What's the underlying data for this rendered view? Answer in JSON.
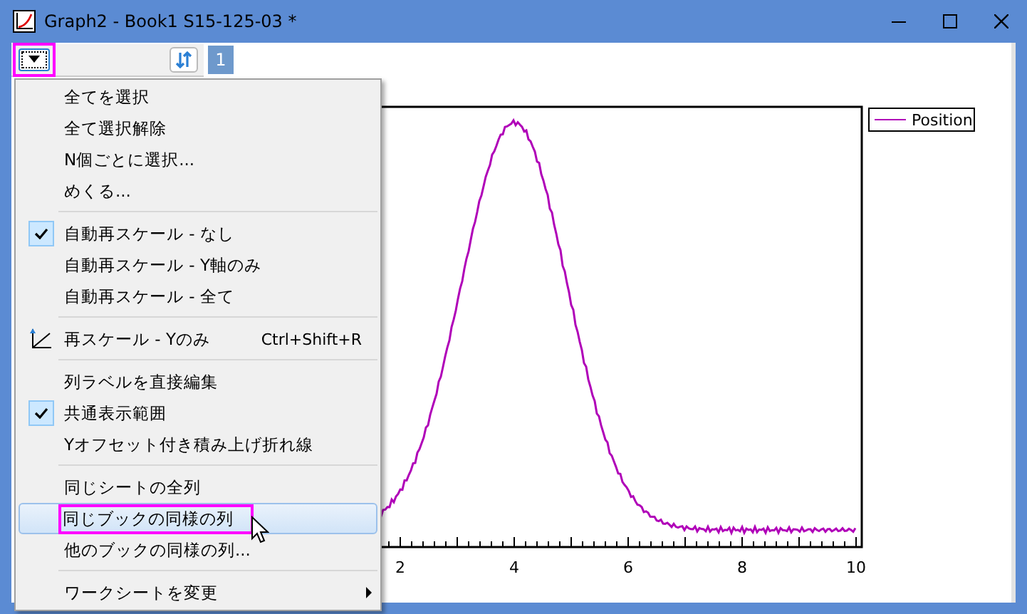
{
  "window": {
    "title": "Graph2 - Book1 S15-125-03 *"
  },
  "toolbar": {
    "dropdown_marked": true,
    "page_tabs": [
      {
        "label": "1",
        "selected": true
      }
    ]
  },
  "menu": {
    "items": [
      {
        "kind": "item",
        "label": "全てを選択",
        "checked": false,
        "selected": false,
        "marked": false
      },
      {
        "kind": "item",
        "label": "全て選択解除",
        "checked": false,
        "selected": false,
        "marked": false
      },
      {
        "kind": "item",
        "label": "N個ごとに選択...",
        "checked": false,
        "selected": false,
        "marked": false
      },
      {
        "kind": "item",
        "label": "めくる...",
        "checked": false,
        "selected": false,
        "marked": false
      },
      {
        "kind": "separator"
      },
      {
        "kind": "item",
        "label": "自動再スケール - なし",
        "checked": true,
        "selected": false,
        "marked": false
      },
      {
        "kind": "item",
        "label": "自動再スケール - Y軸のみ",
        "checked": false,
        "selected": false,
        "marked": false
      },
      {
        "kind": "item",
        "label": "自動再スケール - 全て",
        "checked": false,
        "selected": false,
        "marked": false
      },
      {
        "kind": "separator"
      },
      {
        "kind": "tool",
        "label": "再スケール - Yのみ",
        "shortcut": "Ctrl+Shift+R",
        "checked": false,
        "selected": false,
        "marked": false
      },
      {
        "kind": "separator"
      },
      {
        "kind": "item",
        "label": "列ラベルを直接編集",
        "checked": false,
        "selected": false,
        "marked": false
      },
      {
        "kind": "item",
        "label": "共通表示範囲",
        "checked": true,
        "selected": false,
        "marked": false
      },
      {
        "kind": "item",
        "label": "Yオフセット付き積み上げ折れ線",
        "checked": false,
        "selected": false,
        "marked": false
      },
      {
        "kind": "separator"
      },
      {
        "kind": "item",
        "label": "同じシートの全列",
        "checked": false,
        "selected": false,
        "marked": false
      },
      {
        "kind": "item",
        "label": "同じブックの同様の列",
        "checked": false,
        "selected": true,
        "marked": true
      },
      {
        "kind": "item",
        "label": "他のブックの同様の列...",
        "checked": false,
        "selected": false,
        "marked": false
      },
      {
        "kind": "separator"
      },
      {
        "kind": "submenu",
        "label": "ワークシートを変更",
        "checked": false,
        "selected": false,
        "marked": false
      }
    ]
  },
  "plot": {
    "legend": {
      "label": "Position"
    },
    "x_tick_labels": [
      "2",
      "4",
      "6",
      "8",
      "10"
    ]
  }
}
